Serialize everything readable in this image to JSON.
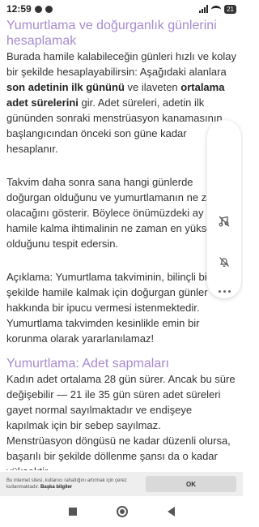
{
  "status_bar": {
    "time": "12:59",
    "battery_level": "21",
    "icons": [
      "notification-dot-icon",
      "notification-dot-icon",
      "signal-icon",
      "wifi-icon",
      "battery-icon"
    ]
  },
  "article": {
    "heading1": "Yumurtlama ve doğurganlık günlerini hesaplamak",
    "p1_a": "Burada hamile kalabileceğin günleri hızlı ve kolay bir şekilde hesaplayabilirsin: Aşağıdaki alanlara ",
    "p1_b": "son adetinin ilk gününü",
    "p1_c": " ve ilaveten ",
    "p1_d": "ortalama adet sürelerini",
    "p1_e": " gir. Adet süreleri, adetin ilk gününden sonraki menstrüasyon kanamasının başlangıcından önceki son güne kadar hesaplanır.",
    "p2": "Takvim daha sonra sana hangi günlerde doğurgan olduğunu ve yumurtlamanın ne zaman olacağını gösterir. Böylece önümüzdeki ay hamile kalma ihtimalinin ne zaman en yüksek olduğunu tespit edersin.",
    "p3": "Açıklama: Yumurtlama takviminin, bilinçli bir şekilde hamile kalmak için doğurgan günler hakkında bir ipucu vermesi istenmektedir.",
    "p4": "Yumurtlama takvimden kesinlikle emin bir korunma olarak yararlanılamaz!",
    "heading2": "Yumurtlama: Adet sapmaları",
    "p5": "Kadın adet ortalama 28 gün sürer. Ancak bu süre değişebilir — 21 ile 35 gün süren adet süreleri gayet normal sayılmaktadır ve endişeye kapılmak için bir sebep sayılmaz.",
    "p6": "Menstrüasyon döngüsü ne kadar düzenli olursa, başarılı bir şekilde döllenme şansı da o kadar yüksektir."
  },
  "floating_panel": {
    "icons": [
      "music-off-icon",
      "notifications-off-icon",
      "more-options-icon"
    ]
  },
  "cookie_banner": {
    "text": "Bu internet sitesi, kullanıcı rahatlığını artırmak için çerez kullanmaktadır.",
    "link": "Başka bilgiler",
    "ok_label": "OK"
  },
  "nav_bar": {
    "icons": [
      "recent-apps-icon",
      "home-icon",
      "back-icon"
    ]
  }
}
